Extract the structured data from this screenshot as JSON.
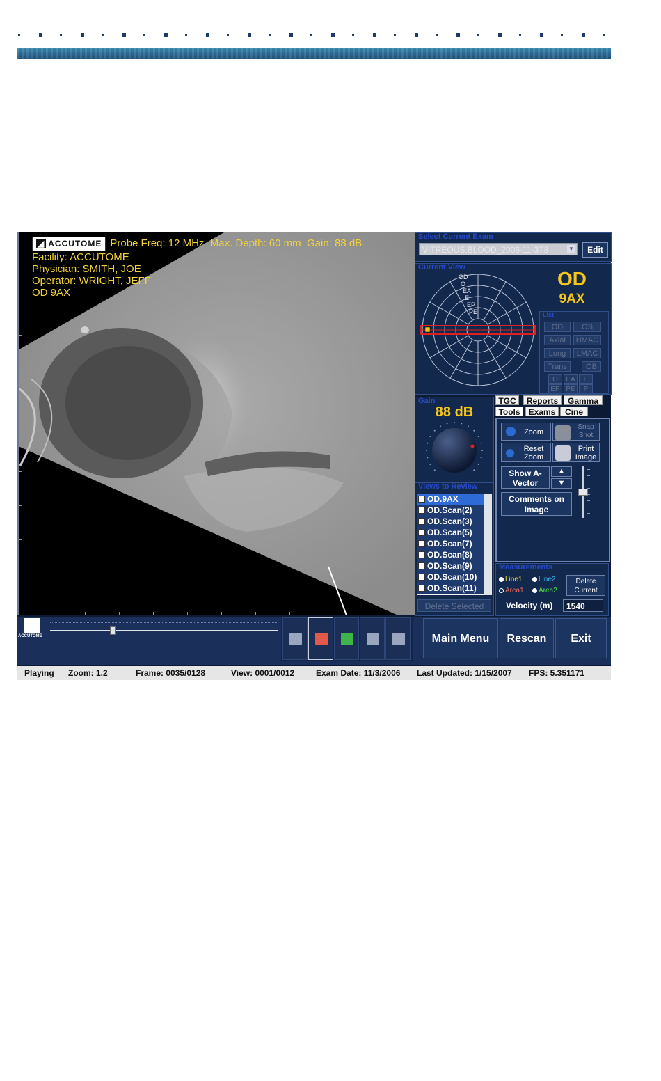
{
  "overlay": {
    "logo": "ACCUTOME",
    "probe_freq": "Probe Freq: 12 MHz",
    "max_depth": "Max. Depth: 60 mm",
    "gain": "Gain: 88 dB",
    "facility": "Facility: ACCUTOME",
    "physician": "Physician: SMITH, JOE",
    "operator": "Operator: WRIGHT, JEFF",
    "view": "OD 9AX"
  },
  "exam": {
    "title": "Select Current Exam",
    "value": "VITREOUS,BLOOD_2006-11-3T8",
    "edit_label": "Edit"
  },
  "current_view": {
    "title": "Current View",
    "eye": "OD",
    "view": "9AX",
    "polar_labels": [
      "OD",
      "O",
      "EA",
      "E",
      "EP",
      "PE"
    ],
    "list_title": "List",
    "buttons": [
      "OD",
      "OS",
      "Axial",
      "HMAC",
      "Long",
      "LMAC",
      "Trans",
      "OB",
      "O",
      "EA",
      "E",
      "EP",
      "PE",
      "P"
    ]
  },
  "gain_panel": {
    "title": "Gain",
    "value": "88 dB"
  },
  "tabs": {
    "row1": [
      "TGC",
      "Reports",
      "Gamma"
    ],
    "row2": [
      "Tools",
      "Exams",
      "Cine"
    ]
  },
  "tools": {
    "zoom": "Zoom",
    "snapshot": "Snap Shot",
    "reset_zoom": "Reset Zoom",
    "print_image": "Print Image",
    "show_a_vector": "Show A-Vector",
    "comments": "Comments on Image"
  },
  "views": {
    "title": "Views to Review",
    "items": [
      "OD.9AX",
      "OD.Scan(2)",
      "OD.Scan(3)",
      "OD.Scan(5)",
      "OD.Scan(7)",
      "OD.Scan(8)",
      "OD.Scan(9)",
      "OD.Scan(10)",
      "OD.Scan(11)"
    ],
    "delete_label": "Delete Selected"
  },
  "measurements": {
    "title": "Measurements",
    "line1": "Line1",
    "line2": "Line2",
    "area1": "Area1",
    "area2": "Area2",
    "delete_current": "Delete Current",
    "velocity_label": "Velocity (m)",
    "velocity_value": "1540",
    "colors": {
      "line1": "#f2d23a",
      "line2": "#35b8f0",
      "area1": "#f06a5a",
      "area2": "#4fe04f"
    }
  },
  "bottom": {
    "logo_text": "ACCUTOME",
    "playback_progress": 0.27,
    "main_menu": "Main Menu",
    "rescan": "Rescan",
    "exit": "Exit"
  },
  "status": {
    "state": "Playing",
    "zoom": "Zoom: 1.2",
    "frame": "Frame: 0035/0128",
    "view": "View: 0001/0012",
    "exam_date": "Exam Date: 11/3/2006",
    "last_updated": "Last Updated: 1/15/2007",
    "fps": "FPS: 5.351171"
  }
}
